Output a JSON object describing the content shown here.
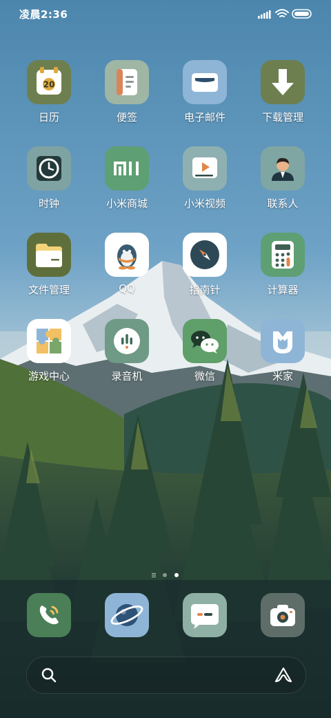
{
  "status_bar": {
    "time": "凌晨2:36",
    "icons": [
      "signal-icon",
      "wifi-icon",
      "battery-icon"
    ]
  },
  "apps": [
    {
      "label": "日历",
      "icon": "calendar-icon",
      "badge": "20",
      "color": "#6e7f4f"
    },
    {
      "label": "便签",
      "icon": "notes-icon",
      "color": "#9fb6a5"
    },
    {
      "label": "电子邮件",
      "icon": "email-icon",
      "color": "#8fb5d6"
    },
    {
      "label": "下载管理",
      "icon": "download-icon",
      "color": "#6e7f4f"
    },
    {
      "label": "时钟",
      "icon": "clock-icon",
      "color": "#7fa3a2"
    },
    {
      "label": "小米商城",
      "icon": "mi-store-icon",
      "color": "#5f9f74"
    },
    {
      "label": "小米视频",
      "icon": "video-icon",
      "color": "#8fb0b0"
    },
    {
      "label": "联系人",
      "icon": "contacts-icon",
      "color": "#7fa6a2"
    },
    {
      "label": "文件管理",
      "icon": "folder-icon",
      "color": "#5f6f3b"
    },
    {
      "label": "QQ",
      "icon": "qq-icon",
      "color": "#ffffff"
    },
    {
      "label": "指南针",
      "icon": "compass-icon",
      "color": "#ffffff"
    },
    {
      "label": "计算器",
      "icon": "calculator-icon",
      "color": "#5f9f74"
    },
    {
      "label": "游戏中心",
      "icon": "game-center-icon",
      "color": "#ffffff"
    },
    {
      "label": "录音机",
      "icon": "recorder-icon",
      "color": "#6f9a86"
    },
    {
      "label": "微信",
      "icon": "wechat-icon",
      "color": "#5f9f6a"
    },
    {
      "label": "米家",
      "icon": "mijia-icon",
      "color": "#8fb5d6"
    }
  ],
  "page_indicator": {
    "pages": 3,
    "current": 3,
    "first_is_list": true
  },
  "dock": [
    {
      "icon": "phone-icon",
      "color": "#4a7f57"
    },
    {
      "icon": "browser-icon",
      "color": "#8fb5d6"
    },
    {
      "icon": "messages-icon",
      "color": "#8fb0a4"
    },
    {
      "icon": "camera-icon",
      "color": "#5f6d68"
    }
  ],
  "search": {
    "left_icon": "search-icon",
    "right_icon": "assistant-icon"
  }
}
